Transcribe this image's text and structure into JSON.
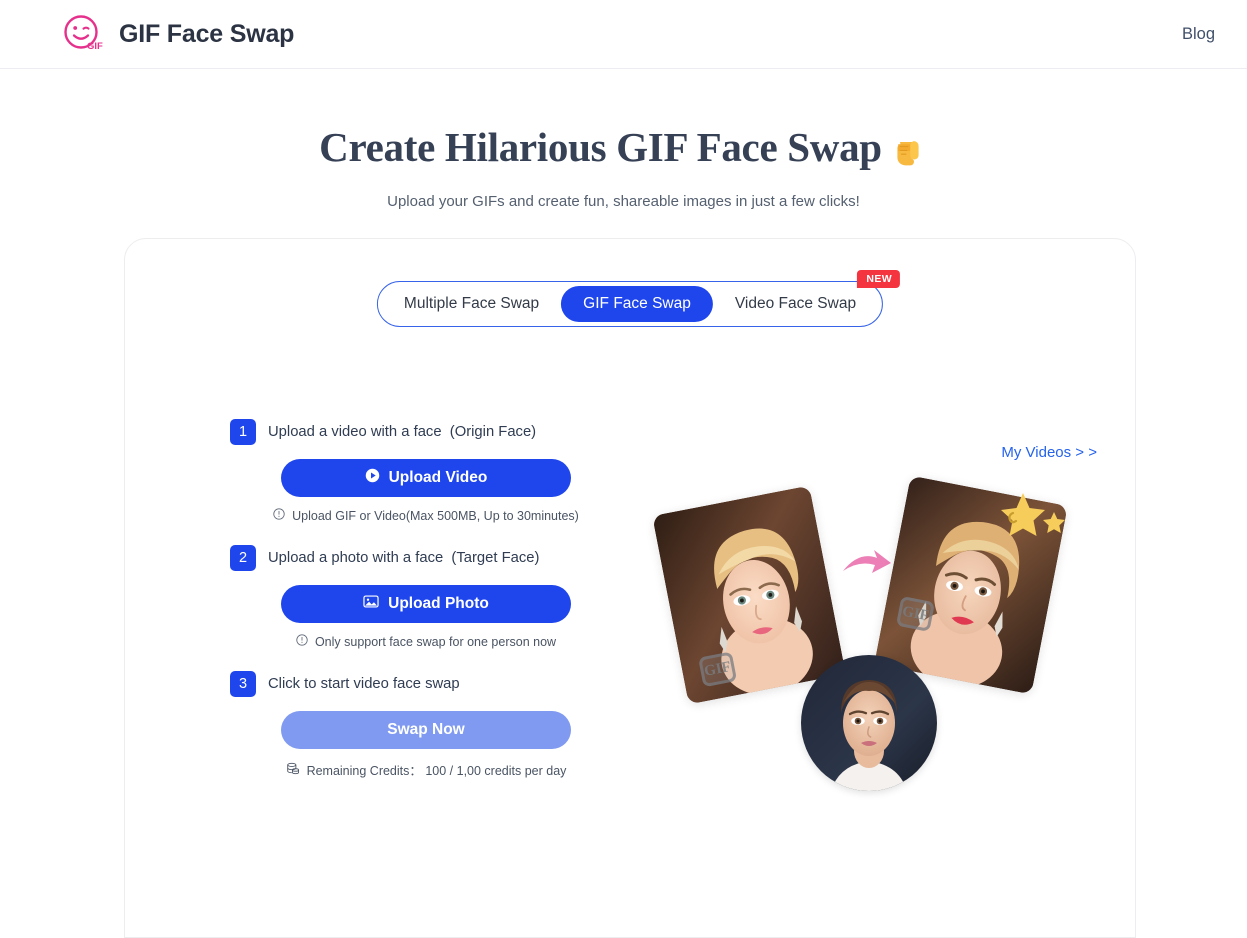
{
  "header": {
    "brand_name": "GIF Face Swap",
    "logo_icon": "gif-smiley-logo",
    "logo_text": "GIF",
    "nav": [
      {
        "label": "Blog",
        "name": "blog"
      }
    ]
  },
  "hero": {
    "title": "Create Hilarious GIF Face Swap",
    "title_emoji": "point-down-hand-emoji",
    "subtitle": "Upload your GIFs and create fun, shareable images in just a few clicks!"
  },
  "tabs": {
    "items": [
      {
        "label": "Multiple Face Swap",
        "active": false
      },
      {
        "label": "GIF Face Swap",
        "active": true
      },
      {
        "label": "Video Face Swap",
        "active": false
      }
    ],
    "badge": "NEW"
  },
  "steps": [
    {
      "number": "1",
      "label": "Upload a video with a face  (Origin Face)",
      "button": "Upload Video",
      "button_icon": "play-circle-icon",
      "button_state": "enabled",
      "hint": "Upload GIF or Video(Max 500MB, Up to 30minutes)",
      "hint_icon": "info-circle-icon"
    },
    {
      "number": "2",
      "label": "Upload a photo with a face  (Target Face)",
      "button": "Upload Photo",
      "button_icon": "image-icon",
      "button_state": "enabled",
      "hint": "Only support face swap for one person now",
      "hint_icon": "info-circle-icon"
    },
    {
      "number": "3",
      "label": "Click to start video face swap",
      "button": "Swap Now",
      "button_icon": "none",
      "button_state": "disabled",
      "hint": "Remaining Credits： 100 / 1,00 credits per day",
      "hint_icon": "coins-icon"
    }
  ],
  "preview": {
    "my_videos_link": "My Videos > >",
    "source_card_watermark": "GIF",
    "result_card_watermark": "GIF",
    "arrow_icon": "pink-curved-arrow-icon",
    "stars_icon": "yellow-stars-icon",
    "avatar_alt": "target-face-avatar"
  },
  "colors": {
    "primary_blue": "#1f46ec",
    "disabled_blue": "#7f9af0",
    "badge_red": "#f4343f",
    "brand_pink": "#e5318c",
    "link_blue": "#2563eb",
    "heading_navy": "#364156",
    "star_yellow": "#f6cd5b",
    "arrow_pink": "#ec7fb6"
  }
}
